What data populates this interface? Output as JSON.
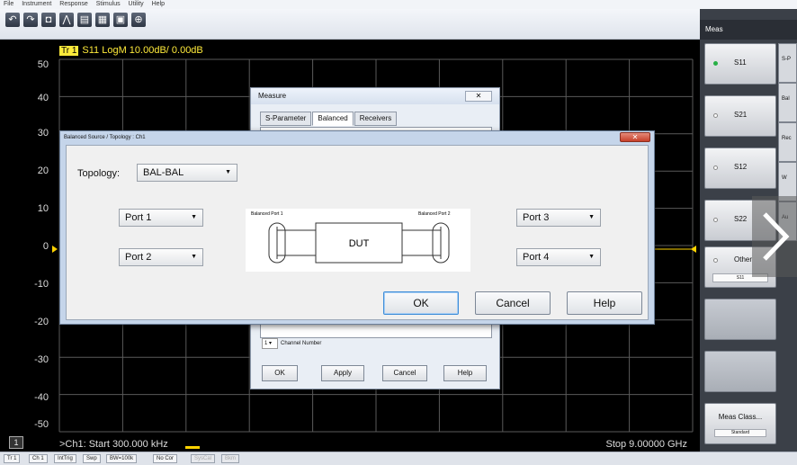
{
  "menu": [
    "File",
    "Instrument",
    "Response",
    "Stimulus",
    "Utility",
    "Help"
  ],
  "toolbar_icons": [
    "undo-icon",
    "redo-icon",
    "camera-icon",
    "marker-icon",
    "table-icon",
    "chart-add-icon",
    "delete-icon",
    "zoom-icon"
  ],
  "chart": {
    "trace_tag": "Tr 1",
    "trace_text": "S11 LogM 10.00dB/ 0.00dB",
    "y_ticks": [
      "50",
      "40",
      "30",
      "20",
      "10",
      "0",
      "-10",
      "-20",
      "-30",
      "-40",
      "-50"
    ],
    "channel_indicator": "1",
    "start": ">Ch1: Start  300.000 kHz",
    "stop": "Stop  9.00000 GHz",
    "trace_color": "#ffd400"
  },
  "statusbar": {
    "items": [
      "Tr 1",
      "Ch 1",
      "IntTrig",
      "Swp",
      "BW=100k",
      "No Cor",
      "SysCal",
      "Bkm"
    ]
  },
  "right_panel": {
    "header": "Meas",
    "softkeys": [
      {
        "label": "S11",
        "active": true
      },
      {
        "label": "S21",
        "active": false
      },
      {
        "label": "S12",
        "active": false
      },
      {
        "label": "S22",
        "active": false
      },
      {
        "label": "Other",
        "active": false,
        "sub": "S11"
      }
    ],
    "meas_class": "Meas Class...",
    "meas_class_sub": "Standard",
    "side_tabs": [
      "S-P",
      "Bal",
      "Rec",
      "W",
      "Au",
      "M"
    ]
  },
  "measure_dialog": {
    "title": "Measure",
    "close": "✕",
    "tabs": [
      "S-Parameter",
      "Balanced",
      "Receivers"
    ],
    "channel_value": "1",
    "channel_label": "Channel Number",
    "buttons": [
      "OK",
      "Apply",
      "Cancel",
      "Help"
    ]
  },
  "topology_dialog": {
    "title": "Balanced Source / Topology : Ch1",
    "close": "✕",
    "topology_label": "Topology:",
    "topology_value": "BAL-BAL",
    "port1": "Port 1",
    "port2": "Port 2",
    "port3": "Port 3",
    "port4": "Port 4",
    "diagram": {
      "left_label": "Balanced Port 1",
      "right_label": "Balanced Port 2",
      "dut": "DUT"
    },
    "ok": "OK",
    "cancel": "Cancel",
    "help": "Help"
  }
}
